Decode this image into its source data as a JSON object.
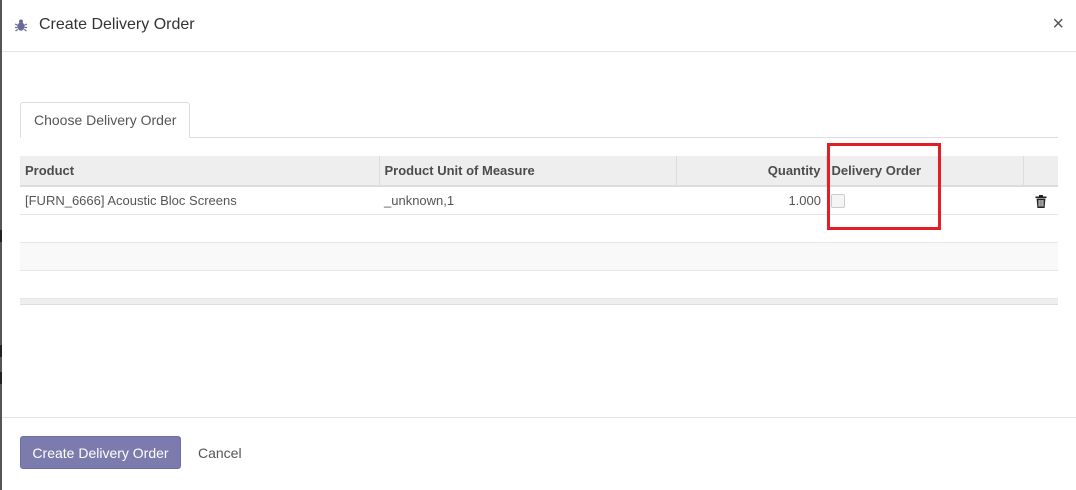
{
  "dialog": {
    "title": "Create Delivery Order",
    "close_label": "×"
  },
  "tabs": [
    {
      "label": "Choose Delivery Order"
    }
  ],
  "table": {
    "headers": [
      "Product",
      "Product Unit of Measure",
      "Quantity",
      "Delivery Order"
    ],
    "rows": [
      {
        "product": "[FURN_6666] Acoustic Bloc Screens",
        "uom": "_unknown,1",
        "quantity": "1.000",
        "delivery_order_checked": false
      }
    ]
  },
  "footer": {
    "primary_label": "Create Delivery Order",
    "cancel_label": "Cancel"
  },
  "colors": {
    "primary": "#7c7bad",
    "highlight": "#e31e24"
  },
  "icons": {
    "title_icon": "bug-icon",
    "row_delete": "trash-icon"
  }
}
